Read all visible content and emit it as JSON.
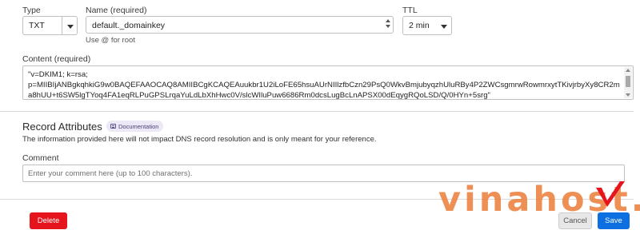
{
  "record": {
    "type_label": "Type",
    "type_value": "TXT",
    "name_label": "Name (required)",
    "name_value": "default._domainkey",
    "name_hint": "Use @ for root",
    "ttl_label": "TTL",
    "ttl_value": "2 min",
    "content_label": "Content (required)",
    "content_value": "\"v=DKIM1; k=rsa;\np=MIIBIjANBgkqhkiG9w0BAQEFAAOCAQ8AMIIBCgKCAQEAuukbr1U2iLoFE65hsuAUrNIIlzfbCzn29PsQ0WkvBmjubyqzhUluRBy4P2ZWCsgmrwRowmrxytTKivjrbyXy8CR2ma8hUU+t6SW5lgTYoq4FA1eqRLPuGPSLrqaYuLdLbXhHwc0V/slcWIluPuw6686Rm0dcsLugBcLnAPSX00dEqygRQoLSD/Q/0HYn+5srg\""
  },
  "attributes": {
    "heading": "Record Attributes",
    "doc_badge": "Documentation",
    "description": "The information provided here will not impact DNS record resolution and is only meant for your reference.",
    "comment_label": "Comment",
    "comment_placeholder": "Enter your comment here (up to 100 characters)."
  },
  "actions": {
    "delete": "Delete",
    "cancel": "Cancel",
    "save": "Save"
  },
  "watermark": {
    "text": "vinahost.",
    "color": "#ec813e"
  },
  "colors": {
    "delete": "#e6141c",
    "save": "#0d6fe0",
    "badge_bg": "#ece8f6"
  },
  "icons": [
    "chevron-down-icon",
    "stepper-icon",
    "documentation-icon",
    "checkmark-icon"
  ]
}
